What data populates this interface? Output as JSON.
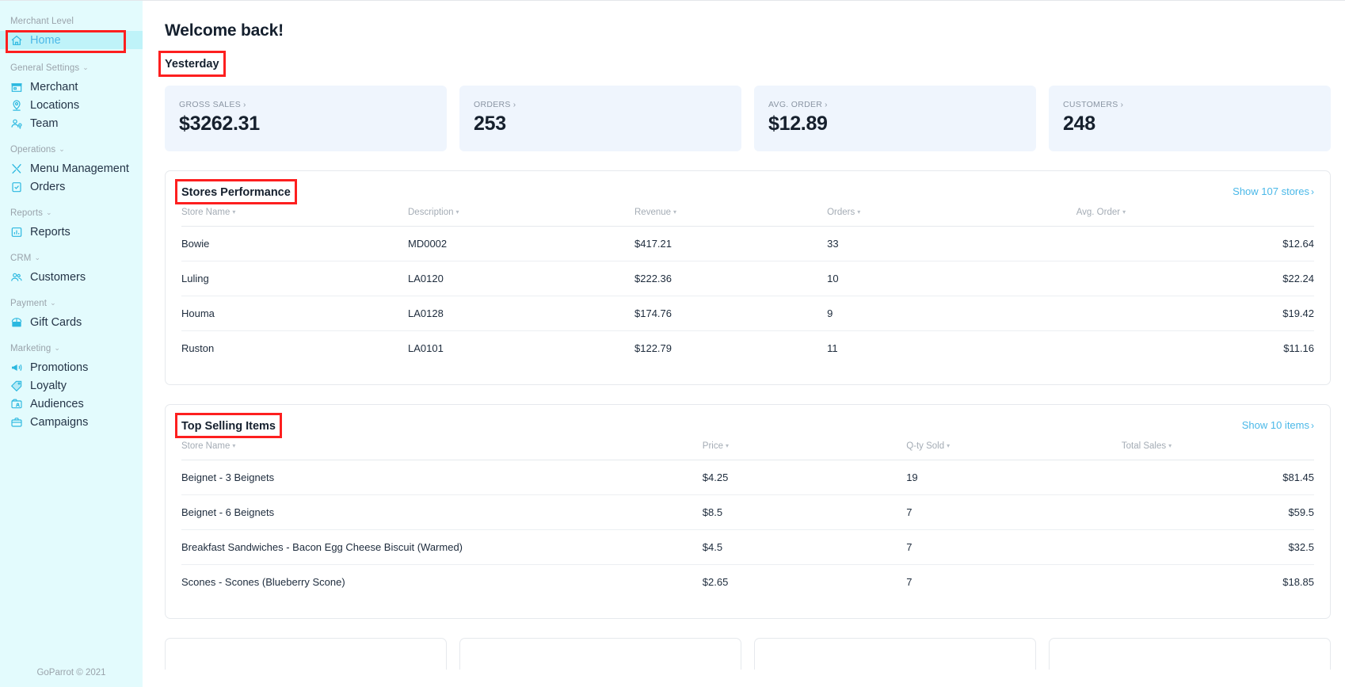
{
  "sidebar": {
    "groups": [
      {
        "label": "Merchant Level",
        "has_caret": false,
        "items": [
          {
            "label": "Home",
            "icon": "home-icon",
            "active": true
          }
        ]
      },
      {
        "label": "General Settings",
        "has_caret": true,
        "items": [
          {
            "label": "Merchant",
            "icon": "store-icon",
            "active": false
          },
          {
            "label": "Locations",
            "icon": "map-pin-icon",
            "active": false
          },
          {
            "label": "Team",
            "icon": "team-icon",
            "active": false
          }
        ]
      },
      {
        "label": "Operations",
        "has_caret": true,
        "items": [
          {
            "label": "Menu Management",
            "icon": "cutlery-icon",
            "active": false
          },
          {
            "label": "Orders",
            "icon": "clipboard-check-icon",
            "active": false
          }
        ]
      },
      {
        "label": "Reports",
        "has_caret": true,
        "items": [
          {
            "label": "Reports",
            "icon": "bar-chart-icon",
            "active": false
          }
        ]
      },
      {
        "label": "CRM",
        "has_caret": true,
        "items": [
          {
            "label": "Customers",
            "icon": "customers-icon",
            "active": false
          }
        ]
      },
      {
        "label": "Payment",
        "has_caret": true,
        "items": [
          {
            "label": "Gift Cards",
            "icon": "gift-card-icon",
            "active": false
          }
        ]
      },
      {
        "label": "Marketing",
        "has_caret": true,
        "items": [
          {
            "label": "Promotions",
            "icon": "megaphone-icon",
            "active": false
          },
          {
            "label": "Loyalty",
            "icon": "tag-icon",
            "active": false
          },
          {
            "label": "Audiences",
            "icon": "audience-folder-icon",
            "active": false
          },
          {
            "label": "Campaigns",
            "icon": "briefcase-icon",
            "active": false
          }
        ]
      }
    ],
    "footer": "GoParrot © 2021"
  },
  "main": {
    "welcome_title": "Welcome back!",
    "period_label": "Yesterday",
    "kpis": [
      {
        "label": "GROSS SALES",
        "chevron": "›",
        "value": "$3262.31"
      },
      {
        "label": "ORDERS",
        "chevron": "›",
        "value": "253"
      },
      {
        "label": "AVG. ORDER",
        "chevron": "›",
        "value": "$12.89"
      },
      {
        "label": "CUSTOMERS",
        "chevron": "›",
        "value": "248"
      }
    ],
    "stores_panel": {
      "title": "Stores Performance",
      "show_link": "Show 107 stores",
      "show_link_chevron": "›",
      "columns": [
        "Store Name",
        "Description",
        "Revenue",
        "Orders",
        "Avg. Order"
      ],
      "rows": [
        {
          "store": "Bowie",
          "description": "MD0002",
          "revenue": "$417.21",
          "orders": "33",
          "avg_order": "$12.64"
        },
        {
          "store": "Luling",
          "description": "LA0120",
          "revenue": "$222.36",
          "orders": "10",
          "avg_order": "$22.24"
        },
        {
          "store": "Houma",
          "description": "LA0128",
          "revenue": "$174.76",
          "orders": "9",
          "avg_order": "$19.42"
        },
        {
          "store": "Ruston",
          "description": "LA0101",
          "revenue": "$122.79",
          "orders": "11",
          "avg_order": "$11.16"
        }
      ]
    },
    "items_panel": {
      "title": "Top Selling Items",
      "show_link": "Show 10 items",
      "show_link_chevron": "›",
      "columns": [
        "Store Name",
        "Price",
        "Q-ty Sold",
        "Total Sales"
      ],
      "rows": [
        {
          "name": "Beignet - 3 Beignets",
          "price": "$4.25",
          "qty": "19",
          "total": "$81.45"
        },
        {
          "name": "Beignet - 6 Beignets",
          "price": "$8.5",
          "qty": "7",
          "total": "$59.5"
        },
        {
          "name": "Breakfast Sandwiches - Bacon Egg Cheese Biscuit (Warmed)",
          "price": "$4.5",
          "qty": "7",
          "total": "$32.5"
        },
        {
          "name": "Scones - Scones (Blueberry Scone)",
          "price": "$2.65",
          "qty": "7",
          "total": "$18.85"
        }
      ]
    },
    "bottom_cards_count": 4
  },
  "colors": {
    "sidebar_bg": "#e3fbfd",
    "sidebar_active_bg": "#bff3f9",
    "accent": "#4ab8e8",
    "icon": "#2bb8e0",
    "kpi_bg": "#eff5fd",
    "highlight": "#fd1f1f",
    "text": "#15202e",
    "muted": "#a4acb5"
  }
}
